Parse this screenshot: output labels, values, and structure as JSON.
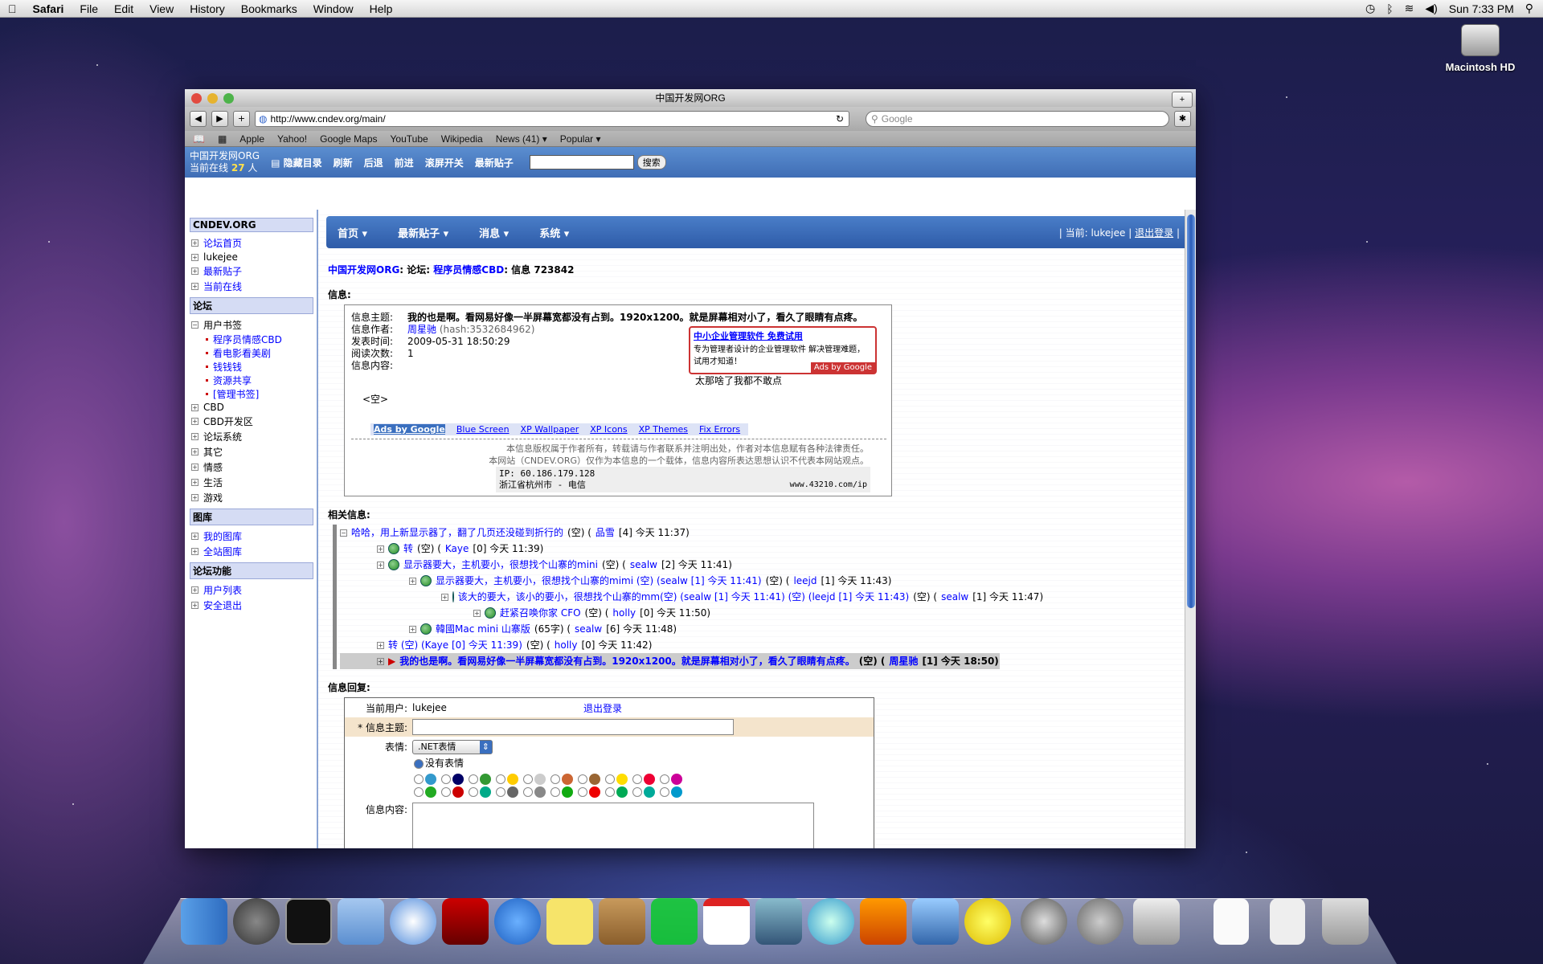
{
  "menubar": {
    "app": "Safari",
    "items": [
      "File",
      "Edit",
      "View",
      "History",
      "Bookmarks",
      "Window",
      "Help"
    ],
    "clock": "Sun 7:33 PM"
  },
  "desktop": {
    "hd_label": "Macintosh HD"
  },
  "window": {
    "title": "中国开发网ORG",
    "url": "http://www.cndev.org/main/",
    "search_placeholder": "Google"
  },
  "bookmarks": [
    "Apple",
    "Yahoo!",
    "Google Maps",
    "YouTube",
    "Wikipedia",
    "News (41) ▾",
    "Popular ▾"
  ],
  "sitebar": {
    "brand": "中国开发网ORG",
    "online_prefix": "当前在线",
    "online_count": "27",
    "online_suffix": "人",
    "actions": [
      "隐藏目录",
      "刷新",
      "后退",
      "前进",
      "滚屏开关",
      "最新贴子"
    ],
    "search_button": "搜索"
  },
  "sidebar": {
    "title": "CNDEV.ORG",
    "top": [
      "论坛首页",
      "lukejee",
      "最新贴子",
      "当前在线"
    ],
    "forum_header": "论坛",
    "bookmarks_label": "用户书签",
    "bookmarks": [
      "程序员情感CBD",
      "看电影看美剧",
      "钱钱钱",
      "资源共享",
      "[管理书签]"
    ],
    "forums": [
      "CBD",
      "CBD开发区",
      "论坛系统",
      "其它",
      "情感",
      "生活",
      "游戏"
    ],
    "gallery_header": "图库",
    "gallery": [
      "我的图库",
      "全站图库"
    ],
    "func_header": "论坛功能",
    "funcs": [
      "用户列表",
      "安全退出"
    ]
  },
  "nav": {
    "items": [
      "首页 ▾",
      "最新贴子 ▾",
      "消息 ▾",
      "系统 ▾"
    ],
    "user_prefix": "| 当前: lukejee |",
    "logout": "退出登录",
    "user_suffix": "|"
  },
  "breadcrumb": {
    "site": "中国开发网ORG",
    "sep1": ": 论坛: ",
    "forum": "程序员情感CBD",
    "sep2": ": 信息 723842"
  },
  "message": {
    "label": "信息:",
    "subject_k": "信息主题:",
    "subject": "我的也是啊。看网易好像一半屏幕宽都没有占到。1920x1200。就是屏幕相对小了，看久了眼睛有点疼。",
    "author_k": "信息作者:",
    "author": "周星驰",
    "hash": "(hash:3532684962)",
    "time_k": "发表时间:",
    "time": "2009-05-31 18:50:29",
    "reads_k": "阅读次数:",
    "reads": "1",
    "content_k": "信息内容:",
    "empty": "<空>",
    "quote": "太那啥了我都不敢点"
  },
  "ad": {
    "title": "中小企业管理软件 免费试用",
    "body": "专为管理者设计的企业管理软件 解决管理难题，试用才知道！",
    "badge": "Ads by Google"
  },
  "adlinks": [
    "Ads by Google",
    "Blue Screen",
    "XP Wallpaper",
    "XP Icons",
    "XP Themes",
    "Fix Errors"
  ],
  "copyright": [
    "本信息版权属于作者所有，转载请与作者联系并注明出处，作者对本信息赋有各种法律责任。",
    "本网站（CNDEV.ORG）仅作为本信息的一个载体，信息内容所表达思想认识不代表本网站观点。"
  ],
  "ip": {
    "line1": "IP: 60.186.179.128",
    "line2": "浙江省杭州市 - 电信",
    "site": "www.43210.com/ip"
  },
  "related": {
    "label": "相关信息:",
    "items": [
      {
        "indent": 0,
        "text": "哈哈，用上新显示器了，翻了几页还没碰到折行的",
        "meta": "(空) (",
        "user": "品雪",
        "tail": "[4] 今天 11:37)"
      },
      {
        "indent": 1,
        "text": "转",
        "meta": "(空) (",
        "user": "Kaye",
        "tail": "[0] 今天 11:39)"
      },
      {
        "indent": 1,
        "text": "显示器要大，主机要小，很想找个山寨的mini",
        "meta": "(空) (",
        "user": "sealw",
        "tail": "[2] 今天 11:41)"
      },
      {
        "indent": 2,
        "text": "显示器要大，主机要小，很想找个山寨的mimi (空) (sealw [1] 今天 11:41)",
        "meta": "(空) (",
        "user": "leejd",
        "tail": "[1] 今天 11:43)"
      },
      {
        "indent": 3,
        "text": "该大的要大，该小的要小，很想找个山寨的mm(空) (sealw [1] 今天 11:41) (空) (leejd [1] 今天 11:43)",
        "meta": "(空) (",
        "user": "sealw",
        "tail": "[1] 今天 11:47)"
      },
      {
        "indent": 4,
        "text": "赶紧召唤你家 CFO",
        "meta": "(空) (",
        "user": "holly",
        "tail": "[0] 今天 11:50)"
      },
      {
        "indent": 2,
        "text": "韓國Mac mini 山寨版",
        "meta": "(65字) (",
        "user": "sealw",
        "tail": "[6] 今天 11:48)"
      },
      {
        "indent": 1,
        "text": "转 (空) (Kaye [0] 今天 11:39)",
        "meta": "(空) (",
        "user": "holly",
        "tail": "[0] 今天 11:42)"
      },
      {
        "indent": 1,
        "text": "我的也是啊。看网易好像一半屏幕宽都没有占到。1920x1200。就是屏幕相对小了，看久了眼睛有点疼。",
        "meta": "(空) (",
        "user": "周星驰",
        "tail": "[1] 今天 18:50)"
      }
    ]
  },
  "reply": {
    "label": "信息回复:",
    "user_k": "当前用户:",
    "user": "lukejee",
    "logout": "退出登录",
    "subject_k": "* 信息主题:",
    "emotion_k": "表情:",
    "emotion_select": ".NET表情",
    "no_emotion": "没有表情",
    "content_k": "信息内容:"
  },
  "colors": {
    "accent": "#3f6db5",
    "link": "#0000ff",
    "highlight": "#cccccc"
  }
}
